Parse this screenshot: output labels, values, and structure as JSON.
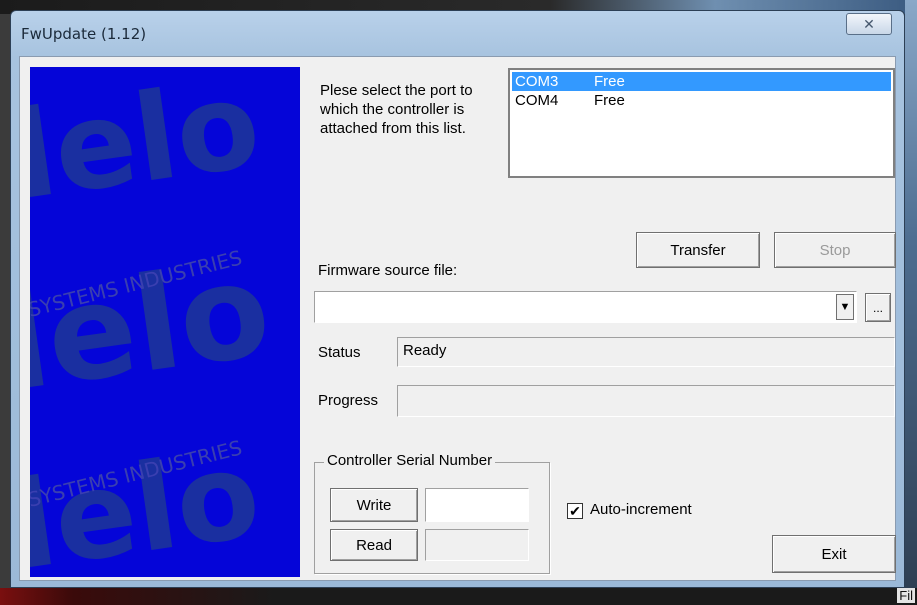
{
  "window": {
    "title": "FwUpdate (1.12)",
    "close_glyph": "✕"
  },
  "background": {
    "corner_text": "Fil"
  },
  "port_select": {
    "instruction": "Plese select the port to which the controller is attached from this list.",
    "ports": [
      {
        "name": "COM3",
        "state": "Free",
        "selected": true
      },
      {
        "name": "COM4",
        "state": "Free",
        "selected": false
      }
    ]
  },
  "buttons": {
    "transfer": "Transfer",
    "stop": "Stop",
    "browse": "...",
    "write": "Write",
    "read": "Read",
    "exit": "Exit"
  },
  "firmware": {
    "label": "Firmware source file:",
    "value": ""
  },
  "status": {
    "label": "Status",
    "value": "Ready"
  },
  "progress": {
    "label": "Progress",
    "value": 0
  },
  "serial": {
    "group_title": "Controller Serial Number",
    "write_value": "",
    "read_value": "",
    "auto_increment_label": "Auto-increment",
    "auto_increment_checked": true
  },
  "banner": {
    "logo_text": "Telelo",
    "tagline": "SYSTEMS INDUSTRIES",
    "color": "#0505d8"
  }
}
